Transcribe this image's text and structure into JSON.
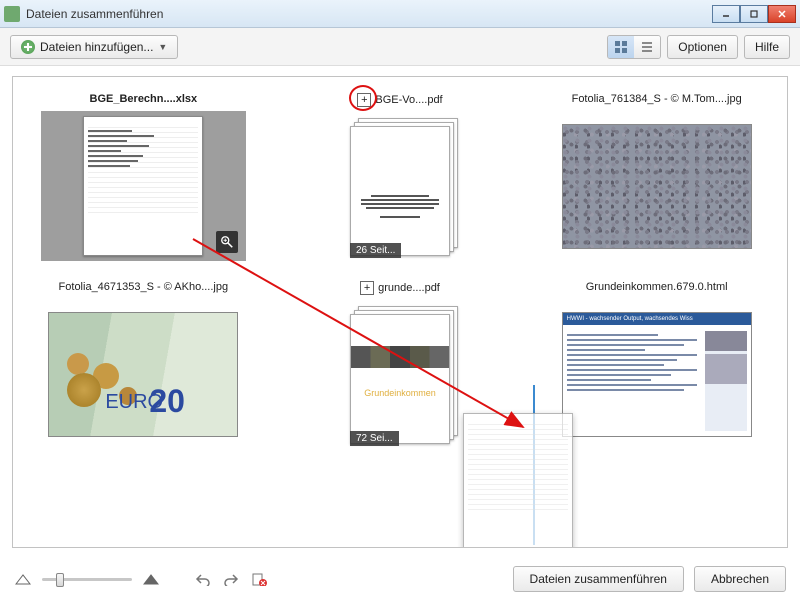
{
  "window": {
    "title": "Dateien zusammenführen"
  },
  "toolbar": {
    "add_files_label": "Dateien hinzufügen...",
    "options_label": "Optionen",
    "help_label": "Hilfe"
  },
  "files": [
    {
      "name": "BGE_Berechn....xlsx",
      "type": "spreadsheet",
      "selected": true
    },
    {
      "name": "BGE-Vo....pdf",
      "type": "pdf",
      "pages_label": "26 Seit...",
      "expandable": true,
      "highlighted_expand": true
    },
    {
      "name": "Fotolia_761384_S - © M.Tom....jpg",
      "type": "image_crowd"
    },
    {
      "name": "Fotolia_4671353_S - © AKho....jpg",
      "type": "image_money"
    },
    {
      "name": "grunde....pdf",
      "type": "pdf_dark",
      "pages_label": "72 Sei...",
      "cover_title": "Grundeinkommen",
      "expandable": true
    },
    {
      "name": "Grundeinkommen.679.0.html",
      "type": "webpage",
      "header_text": "HWWI - wachsender Output, wachsendes Wiss"
    }
  ],
  "footer": {
    "merge_label": "Dateien zusammenführen",
    "cancel_label": "Abbrechen"
  },
  "money_thumb": {
    "big_number": "20",
    "currency_word": "EURO"
  }
}
